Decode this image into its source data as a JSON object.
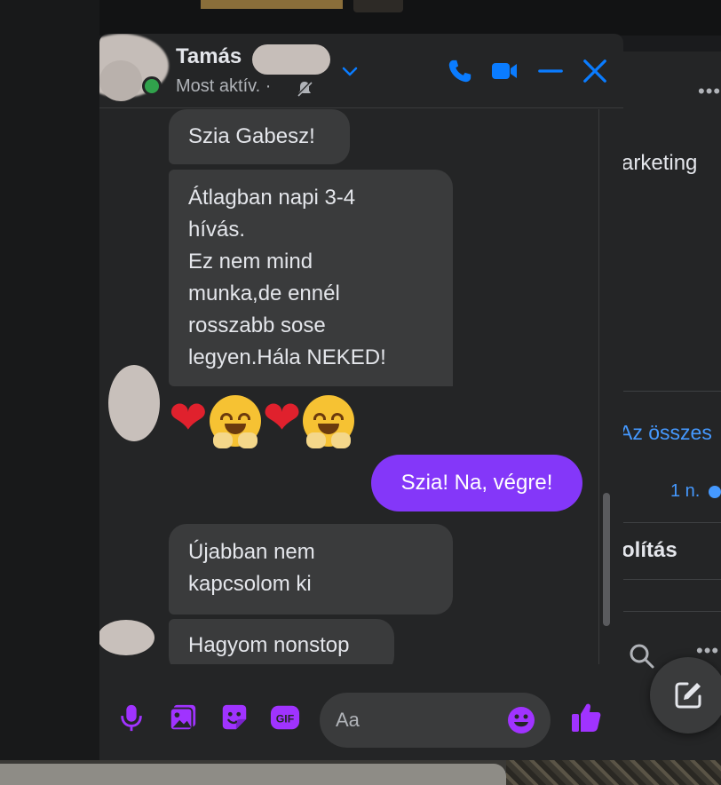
{
  "colors": {
    "accent": "#0a7cff",
    "own_bubble": "#8437f9",
    "composer_icons": "#a033ff",
    "online": "#31a24c",
    "link_blue": "#4599ff"
  },
  "header": {
    "name": "Tamás",
    "status": "Most aktív. ·",
    "icons": [
      "phone-icon",
      "video-icon",
      "minimize-icon",
      "close-icon",
      "chevron-down-icon",
      "mute-icon"
    ]
  },
  "messages": [
    {
      "from": "them",
      "text": "Szia Gabesz!"
    },
    {
      "from": "them",
      "text": "Átlagban napi 3-4\nhívás.\nEz nem mind\nmunka,de ennél\nrosszabb sose\nlegyen.Hála NEKED!"
    },
    {
      "from": "them",
      "text": "❤ ❤",
      "kind": "emoji"
    },
    {
      "from": "me",
      "text": "Szia! Na, végre!"
    },
    {
      "from": "them",
      "text": "Újabban nem\nkapcsolom ki"
    },
    {
      "from": "them",
      "text": "Hagyom nonstop"
    }
  ],
  "composer": {
    "placeholder": "Aa",
    "icons": [
      "microphone-icon",
      "photo-icon",
      "sticker-icon",
      "gif-icon",
      "emoji-icon",
      "thumbs-up-icon"
    ],
    "gif_label": "GIF"
  },
  "background_panel": {
    "more_label": "•••",
    "marketing_text": "arketing",
    "see_all_text": "Az összes",
    "time_text": "1 n.",
    "olitas_text": "olítás"
  }
}
